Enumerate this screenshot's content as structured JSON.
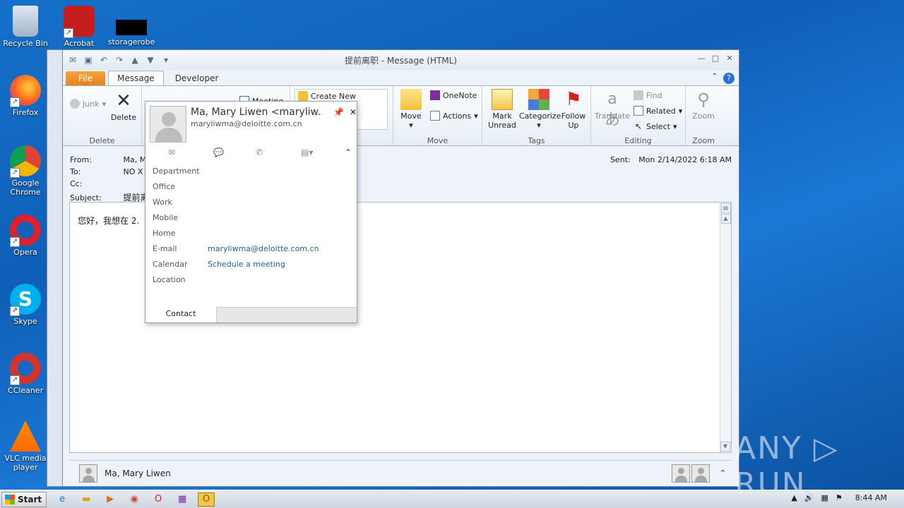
{
  "desktop": {
    "icons": [
      {
        "label": "Recycle Bin"
      },
      {
        "label": "Acrobat"
      },
      {
        "label": "storagerobe"
      },
      {
        "label": "Firefox"
      },
      {
        "label": "Google Chrome"
      },
      {
        "label": "Opera"
      },
      {
        "label": "Skype"
      },
      {
        "label": "CCleaner"
      },
      {
        "label": "VLC media player"
      }
    ],
    "watermark": "ANY ▷ RUN"
  },
  "window": {
    "title": "提前离职 - Message (HTML)",
    "tabs": [
      {
        "label": "File"
      },
      {
        "label": "Message"
      },
      {
        "label": "Developer"
      }
    ],
    "ribbon": {
      "delete_group": {
        "label": "Delete",
        "junk": "Junk",
        "delete": "Delete"
      },
      "quicksteps": {
        "meeting": "Meeting",
        "create_new": "Create New"
      },
      "move_group": {
        "label": "Move",
        "move": "Move",
        "onenote": "OneNote",
        "actions": "Actions"
      },
      "tags_group": {
        "label": "Tags",
        "mark_unread": "Mark Unread",
        "categorize": "Categorize",
        "follow_up": "Follow Up"
      },
      "editing_group": {
        "label": "Editing",
        "translate": "Translate",
        "find": "Find",
        "related": "Related",
        "select": "Select"
      },
      "zoom_group": {
        "label": "Zoom",
        "zoom": "Zoom"
      }
    },
    "header": {
      "from_label": "From:",
      "from_value": "Ma, M",
      "to_label": "To:",
      "to_value": "NO X I",
      "cc_label": "Cc:",
      "subject_label": "Subject:",
      "subject_value": "提前离",
      "sent_label": "Sent:",
      "sent_value": "Mon 2/14/2022 6:18 AM"
    },
    "body_text": "您好，我想在 2.",
    "people_pane": {
      "name": "Ma, Mary Liwen"
    }
  },
  "contact_card": {
    "name": "Ma, Mary Liwen <maryliw...",
    "email": "maryliwma@deloitte.com.cn",
    "rows": [
      {
        "key": "Department",
        "value": ""
      },
      {
        "key": "Office",
        "value": ""
      },
      {
        "key": "Work",
        "value": ""
      },
      {
        "key": "Mobile",
        "value": ""
      },
      {
        "key": "Home",
        "value": ""
      },
      {
        "key": "E-mail",
        "value": "maryliwma@deloitte.com.cn"
      },
      {
        "key": "Calendar",
        "value": "Schedule a meeting"
      },
      {
        "key": "Location",
        "value": ""
      }
    ],
    "footer_tab": "Contact"
  },
  "taskbar": {
    "start": "Start",
    "time": "8:44 AM"
  }
}
